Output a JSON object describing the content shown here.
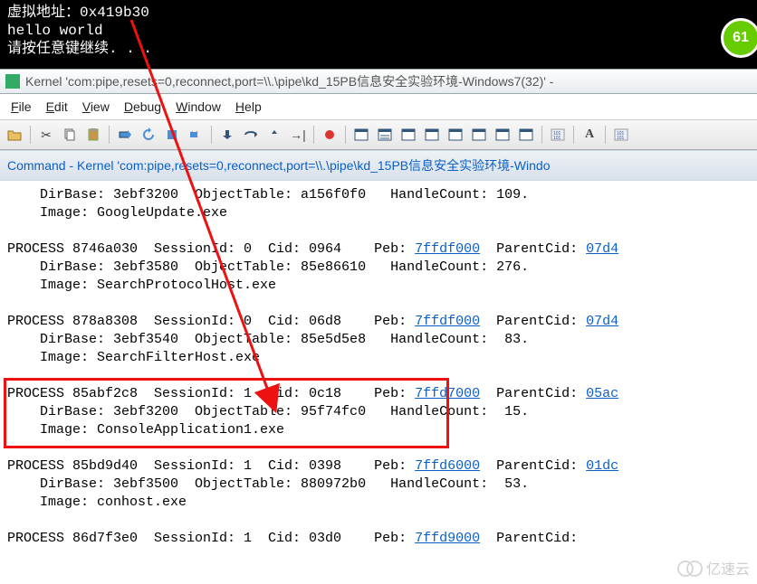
{
  "console": {
    "line1": "虚拟地址：0x419b30",
    "line2": "hello world",
    "line3": "请按任意键继续. . ."
  },
  "badge": {
    "text": "61"
  },
  "title_bar": {
    "text": "Kernel 'com:pipe,resets=0,reconnect,port=\\\\.\\pipe\\kd_15PB信息安全实验环境-Windows7(32)' -"
  },
  "menu": {
    "file": "File",
    "edit": "Edit",
    "view": "View",
    "debug": "Debug",
    "window": "Window",
    "help": "Help"
  },
  "cmd_title": "Command - Kernel 'com:pipe,resets=0,reconnect,port=\\\\.\\pipe\\kd_15PB信息安全实验环境-Windo",
  "processes": [
    {
      "header": "",
      "line1": "    DirBase: 3ebf3200  ObjectTable: a156f0f0   HandleCount: 109.",
      "line2": "    Image: GoogleUpdate.exe"
    },
    {
      "header": "PROCESS 8746a030  SessionId: 0  Cid: 0964    Peb: ",
      "peb": "7ffdf000",
      "parent_pre": "  ParentCid: ",
      "parent": "07d4",
      "line1": "    DirBase: 3ebf3580  ObjectTable: 85e86610   HandleCount: 276.",
      "line2": "    Image: SearchProtocolHost.exe"
    },
    {
      "header": "PROCESS 878a8308  SessionId: 0  Cid: 06d8    Peb: ",
      "peb": "7ffdf000",
      "parent_pre": "  ParentCid: ",
      "parent": "07d4",
      "line1": "    DirBase: 3ebf3540  ObjectTable: 85e5d5e8   HandleCount:  83.",
      "line2": "    Image: SearchFilterHost.exe"
    },
    {
      "header": "PROCESS 85abf2c8  SessionId: 1  Cid: 0c18    Peb: ",
      "peb": "7ffd7000",
      "parent_pre": "  ParentCid: ",
      "parent": "05ac",
      "line1": "    DirBase: 3ebf3200  ObjectTable: 95f74fc0   HandleCount:  15.",
      "line2": "    Image: ConsoleApplication1.exe"
    },
    {
      "header": "PROCESS 85bd9d40  SessionId: 1  Cid: 0398    Peb: ",
      "peb": "7ffd6000",
      "parent_pre": "  ParentCid: ",
      "parent": "01dc",
      "line1": "    DirBase: 3ebf3500  ObjectTable: 880972b0   HandleCount:  53.",
      "line2": "    Image: conhost.exe"
    },
    {
      "header": "PROCESS 86d7f3e0  SessionId: 1  Cid: 03d0    Peb: ",
      "peb": "7ffd9000",
      "parent_pre": "  ParentCid: ",
      "parent": ""
    }
  ],
  "watermark": "亿速云"
}
